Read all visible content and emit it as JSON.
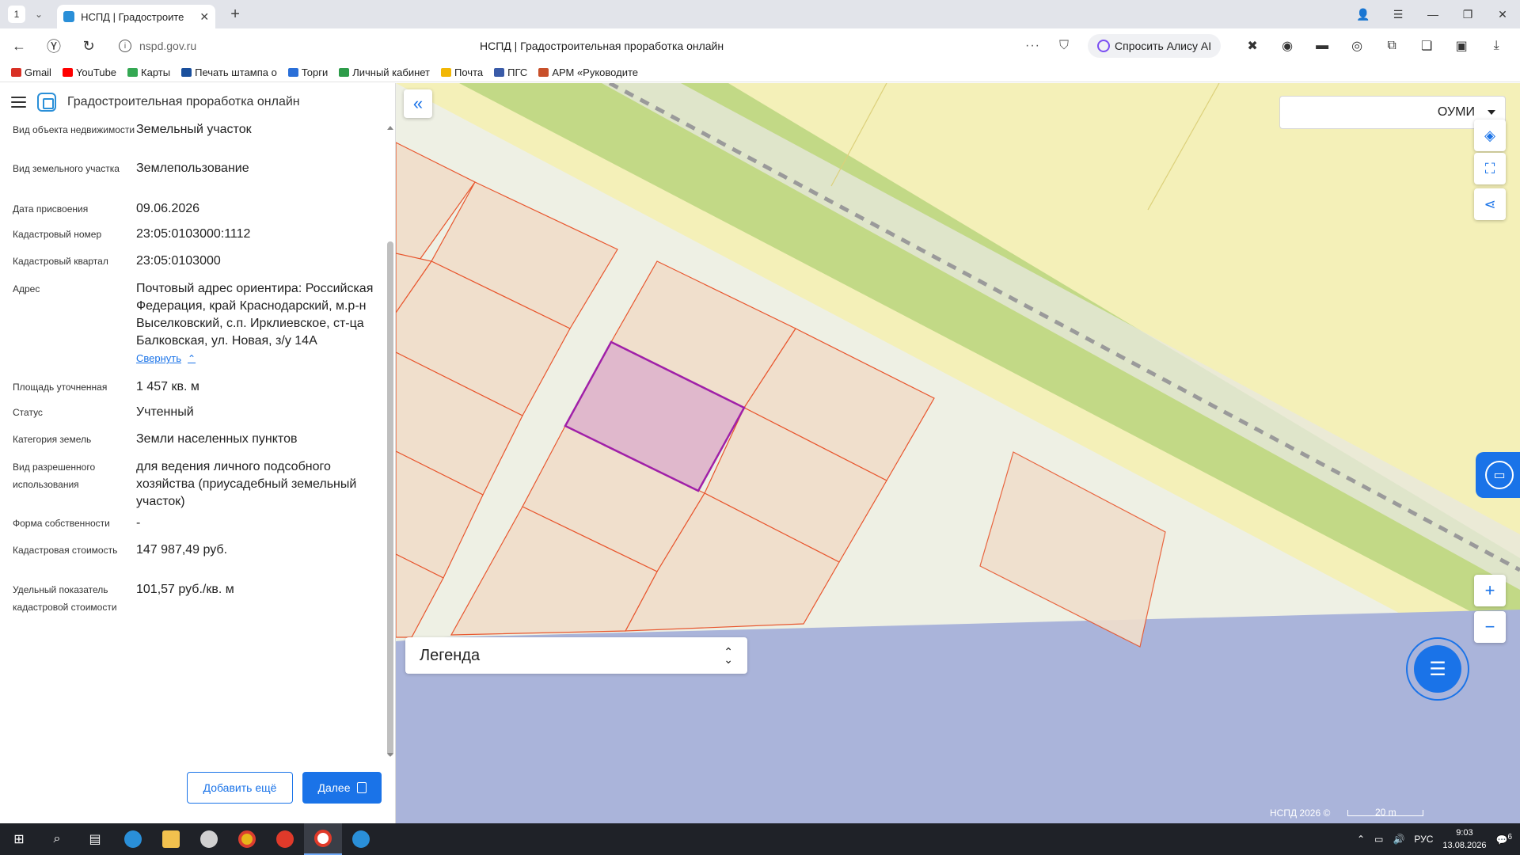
{
  "browser": {
    "tab_count": "1",
    "tab_title": "НСПД | Градостроите",
    "url_domain": "nspd.gov.ru",
    "page_title": "НСПД | Градостроительная проработка онлайн",
    "alice_label": "Спросить Алису AI",
    "bookmarks": [
      {
        "label": "Gmail",
        "color": "#d93025"
      },
      {
        "label": "YouTube",
        "color": "#ff0000"
      },
      {
        "label": "Карты",
        "color": "#34a853"
      },
      {
        "label": "Печать штампа о",
        "color": "#1a4f9c"
      },
      {
        "label": "Торги",
        "color": "#2a6fd8"
      },
      {
        "label": "Личный кабинет",
        "color": "#2e9c4a"
      },
      {
        "label": "Почта",
        "color": "#f2b705"
      },
      {
        "label": "ПГС",
        "color": "#3a5ba8"
      },
      {
        "label": "АРМ «Руководите",
        "color": "#c8502a"
      }
    ]
  },
  "panel": {
    "app_title": "Градостроительная проработка онлайн",
    "attributes": [
      {
        "label": "Вид объекта недвижимости",
        "value": "Земельный участок"
      },
      {
        "label": "Вид земельного участка",
        "value": "Землепользование"
      },
      {
        "label": "Дата присвоения",
        "value": "09.06.2026"
      },
      {
        "label": "Кадастровый номер",
        "value": "23:05:0103000:1112"
      },
      {
        "label": "Кадастровый квартал",
        "value": "23:05:0103000"
      },
      {
        "label": "Адрес",
        "value": "Почтовый адрес ориентира: Российская Федерация, край Краснодарский, м.р-н Выселковский, с.п. Ирклиевское, ст-ца Балковская, ул. Новая, з/у 14А"
      },
      {
        "label": "Площадь уточненная",
        "value": "1 457 кв. м"
      },
      {
        "label": "Статус",
        "value": "Учтенный"
      },
      {
        "label": "Категория земель",
        "value": "Земли населенных пунктов"
      },
      {
        "label": "Вид разрешенного использования",
        "value": "для ведения личного подсобного хозяйства (приусадебный земельный участок)"
      },
      {
        "label": "Форма собственности",
        "value": "-"
      },
      {
        "label": "Кадастровая стоимость",
        "value": "147 987,49 руб."
      },
      {
        "label": "Удельный показатель кадастровой стоимости",
        "value": "101,57 руб./кв. м"
      }
    ],
    "collapse_label": "Свернуть",
    "add_more_label": "Добавить ещё",
    "next_label": "Далее"
  },
  "map": {
    "layer_select": "ОУМИ",
    "legend_label": "Легенда",
    "copyright": "НСПД 2026 ©",
    "scale_label": "20 m",
    "colors": {
      "parcel_fill": "#f0dfcc",
      "parcel_stroke": "#e8562e",
      "selected_fill": "#e0b8cc",
      "selected_stroke": "#a020a8",
      "green_strip": "#c2d986",
      "yellow_zone": "#f4f0b8",
      "water": "#aab4da"
    }
  },
  "taskbar": {
    "language": "РУС",
    "time": "9:03",
    "date": "13.08.2026",
    "notifications": "6"
  }
}
